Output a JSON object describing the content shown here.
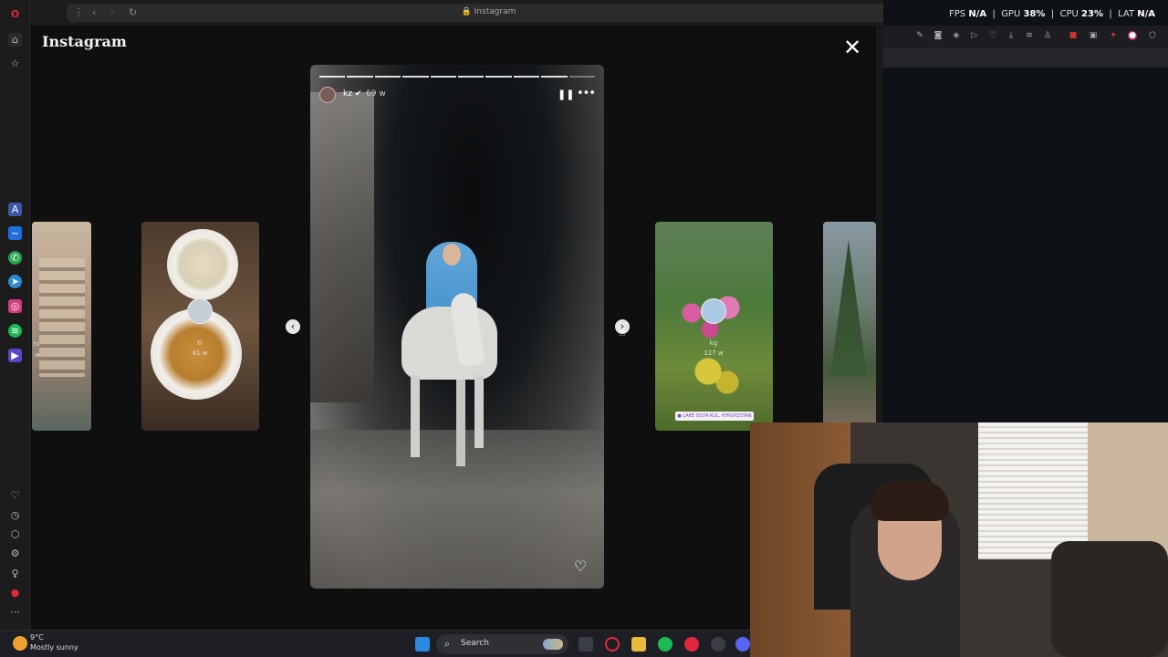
{
  "browser": {
    "url": "Instagram"
  },
  "instagram": {
    "logo": "Instagram",
    "close_label": "✕",
    "story": {
      "username": "kz",
      "verified": "✔",
      "time": "69 w",
      "progress_total": 10,
      "progress_done": 9
    },
    "left_thumb_label": "tr",
    "left_thumb_time": "41 w",
    "far_left_label": "ts",
    "far_left_time": "w",
    "right_thumb_label": "kg",
    "right_thumb_time": "127 w",
    "right_thumb_tag": "● LAKE ISSYK-KUL, KYRGYZSTAN"
  },
  "perf": {
    "fps_label": "FPS",
    "fps_value": "N/A",
    "gpu_label": "GPU",
    "gpu_value": "38%",
    "cpu_label": "CPU",
    "cpu_value": "23%",
    "lat_label": "LAT",
    "lat_value": "N/A"
  },
  "taskbar": {
    "temp": "9°C",
    "weather": "Mostly sunny",
    "search": "Search"
  },
  "icons": {
    "back": "back-arrow-icon",
    "forward": "forward-arrow-icon",
    "reload": "reload-icon",
    "lock": "lock-icon",
    "pause": "pause-icon",
    "more": "more-icon",
    "heart": "heart-icon"
  }
}
